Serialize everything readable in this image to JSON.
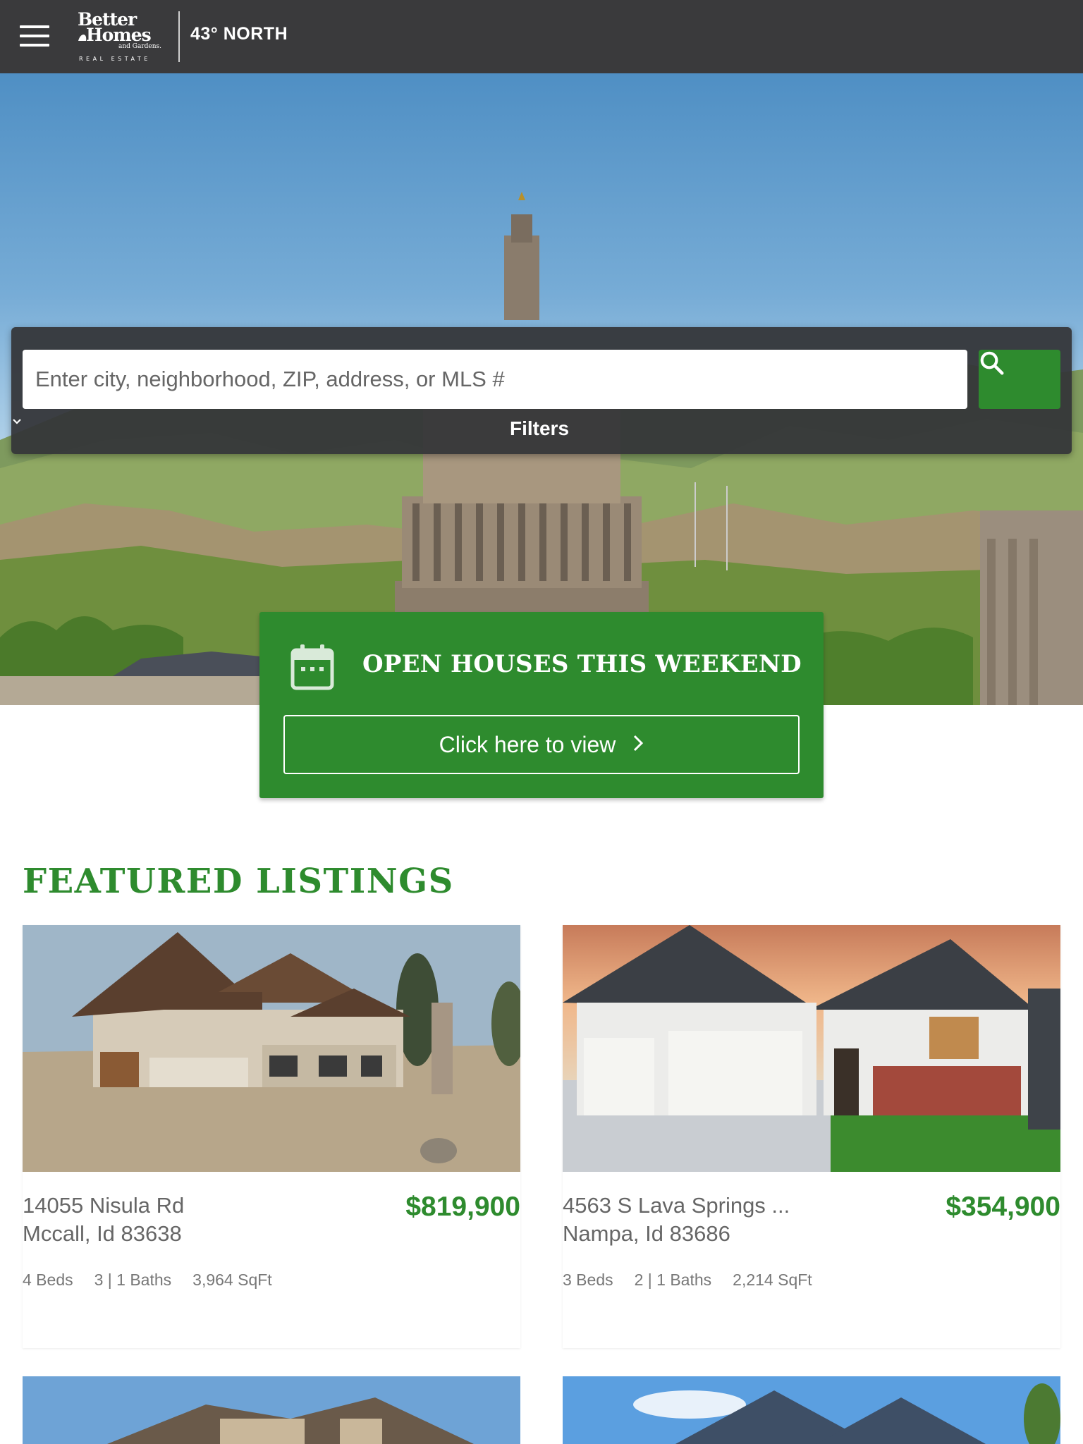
{
  "header": {
    "logo_line1": "Better",
    "logo_line2": "Homes",
    "logo_line3": "and Gardens.",
    "logo_line4": "REAL ESTATE",
    "office_name": "43° NORTH"
  },
  "search": {
    "placeholder": "Enter city, neighborhood, ZIP, address, or MLS #",
    "filters_label": "Filters"
  },
  "open_houses": {
    "title": "OPEN HOUSES THIS WEEKEND",
    "button_label": "Click here to view"
  },
  "featured": {
    "title": "FEATURED LISTINGS",
    "listings": [
      {
        "address_line1": "14055 Nisula Rd",
        "address_line2": "Mccall, Id 83638",
        "price": "$819,900",
        "beds": "4 Beds",
        "baths": "3 | 1 Baths",
        "sqft": "3,964 SqFt"
      },
      {
        "address_line1": "4563 S Lava Springs ...",
        "address_line2": "Nampa, Id 83686",
        "price": "$354,900",
        "beds": "3 Beds",
        "baths": "2 | 1 Baths",
        "sqft": "2,214 SqFt"
      }
    ]
  },
  "colors": {
    "brand_green": "#2e8b2e",
    "header_bg": "#3a3a3c"
  },
  "icons": [
    "menu-icon",
    "search-icon",
    "chevron-down-icon",
    "calendar-icon",
    "chevron-right-icon"
  ]
}
